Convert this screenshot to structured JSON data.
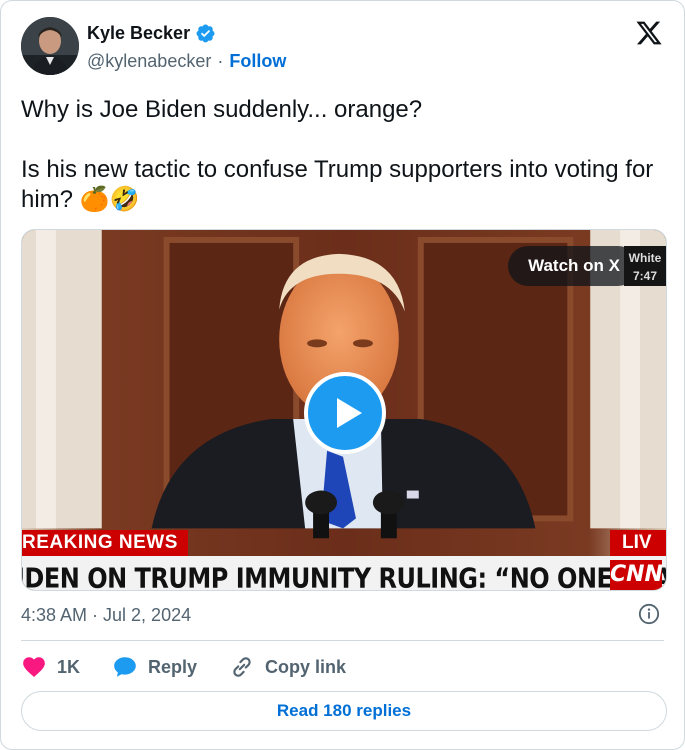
{
  "author": {
    "name": "Kyle Becker",
    "handle": "@kylenabecker",
    "separator": "·",
    "follow_label": "Follow"
  },
  "tweet": {
    "text": "Why is Joe Biden suddenly... orange?\n\nIs his new tactic to confuse Trump supporters into voting for him? 🍊🤣"
  },
  "media": {
    "watch_label": "Watch on X",
    "corner_text_1": "White",
    "corner_text_2": "7:47",
    "breaking_label": "REAKING NEWS",
    "live_label": "LIV",
    "chyron_text": "IDEN ON TRUMP IMMUNITY RULING: “NO ONE IS ABOVE THE LAW”",
    "network_logo": "CNN"
  },
  "meta": {
    "timestamp": "4:38 AM · Jul 2, 2024"
  },
  "actions": {
    "likes_count": "1K",
    "reply_label": "Reply",
    "copy_link_label": "Copy link"
  },
  "footer": {
    "read_replies_label": "Read 180 replies"
  },
  "colors": {
    "accent": "#1d9bf0",
    "link": "#006fd6",
    "like": "#f91880",
    "muted": "#536471",
    "breaking_red": "#cc0000"
  },
  "icons": {
    "verified": "verified-badge-icon",
    "brand": "x-logo-icon",
    "play": "play-icon",
    "info": "info-icon",
    "like": "heart-icon",
    "reply": "speech-bubble-icon",
    "copy": "link-icon"
  }
}
